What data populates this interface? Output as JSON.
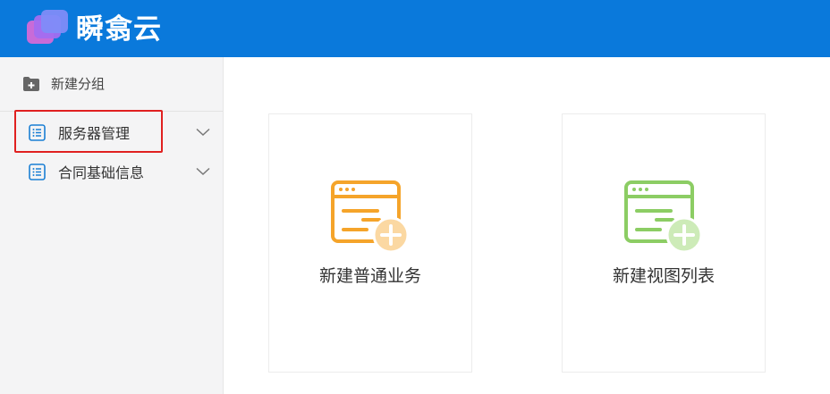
{
  "app": {
    "brand": "瞬翕云"
  },
  "colors": {
    "header": "#0a79db",
    "highlight": "#e02020",
    "orange": "#f5a42a",
    "green": "#8ccd64",
    "nav_icon": "#1a7fd4"
  },
  "sidebar": {
    "new_group_label": "新建分组",
    "items": [
      {
        "label": "服务器管理",
        "icon": "list-icon"
      },
      {
        "label": "合同基础信息",
        "icon": "list-icon"
      }
    ]
  },
  "cards": [
    {
      "label": "新建普通业务",
      "icon": "window-add-icon"
    },
    {
      "label": "新建视图列表",
      "icon": "window-add-icon"
    }
  ]
}
